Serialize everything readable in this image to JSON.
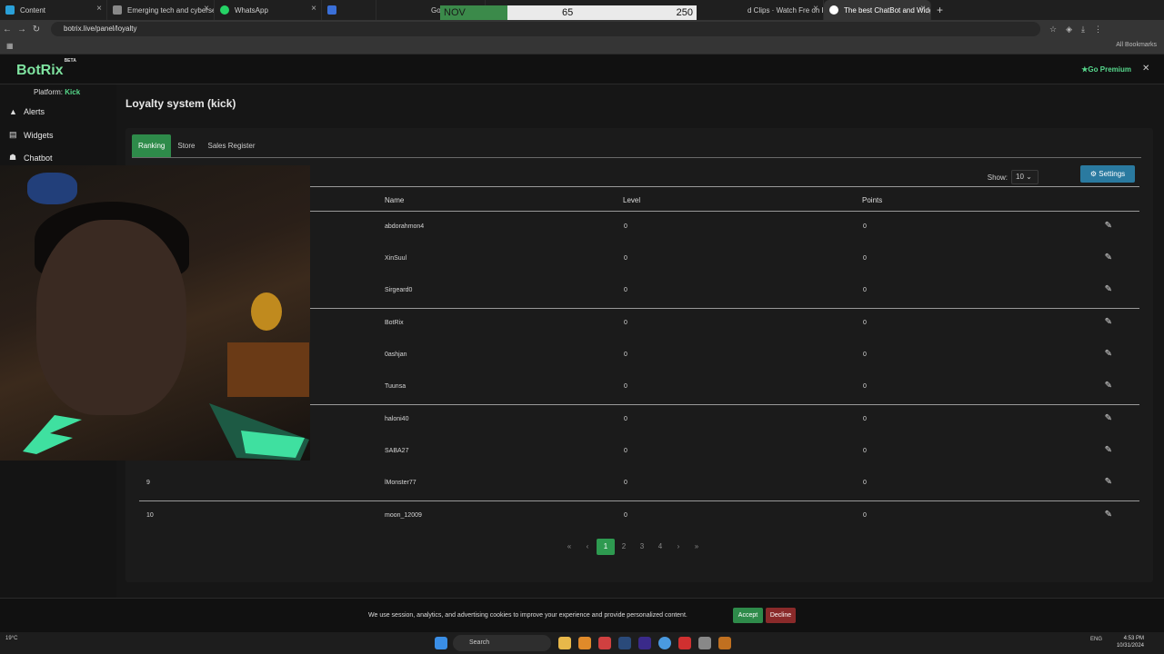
{
  "browser": {
    "tabs": [
      {
        "label": "Content",
        "color": "#2aa0d8"
      },
      {
        "label": "Emerging tech and cybersecur",
        "color": "#888888"
      },
      {
        "label": "WhatsApp",
        "color": "#25d366"
      },
      {
        "label": "",
        "color": "#3a6fd8"
      },
      {
        "label": "Google sugg",
        "color": "#888888"
      },
      {
        "label": "d Clips · Watch Fre on Ki",
        "color": "#888888"
      },
      {
        "label": "The best ChatBot and Widgets",
        "color": "#ffffff"
      }
    ],
    "overlay": {
      "month": "NOV",
      "value_a": "65",
      "value_b": "250"
    },
    "url": "botrix.live/panel/loyalty",
    "all_bookmarks": "All Bookmarks"
  },
  "app": {
    "logo": "BotRix",
    "logo_badge": "BETA",
    "premium_label": "Go Premium",
    "platform_prefix": "Platform:",
    "platform_value": "Kick",
    "sidebar": [
      {
        "label": "Alerts",
        "icon": "warning-icon"
      },
      {
        "label": "Widgets",
        "icon": "widgets-icon"
      },
      {
        "label": "Chatbot",
        "icon": "robot-icon"
      }
    ],
    "page_title": "Loyalty system (kick)",
    "tabs": [
      "Ranking",
      "Store",
      "Sales Register"
    ],
    "show_label": "Show:",
    "show_value": "10",
    "settings_label": "Settings",
    "columns": {
      "name": "Name",
      "level": "Level",
      "points": "Points"
    },
    "rows": [
      {
        "rank": "",
        "name": "abdorahmon4",
        "level": "0",
        "points": "0"
      },
      {
        "rank": "",
        "name": "XinSuul",
        "level": "0",
        "points": "0"
      },
      {
        "rank": "",
        "name": "Sirgeard0",
        "level": "0",
        "points": "0"
      },
      {
        "rank": "",
        "name": "BotRix",
        "level": "0",
        "points": "0"
      },
      {
        "rank": "",
        "name": "0ashjan",
        "level": "0",
        "points": "0"
      },
      {
        "rank": "",
        "name": "Tuunsa",
        "level": "0",
        "points": "0"
      },
      {
        "rank": "",
        "name": "haloni40",
        "level": "0",
        "points": "0"
      },
      {
        "rank": "",
        "name": "SABA27",
        "level": "0",
        "points": "0"
      },
      {
        "rank": "9",
        "name": "lMonster77",
        "level": "0",
        "points": "0"
      },
      {
        "rank": "10",
        "name": "moon_12009",
        "level": "0",
        "points": "0"
      }
    ],
    "pager": {
      "first": "«",
      "prev": "‹",
      "pages": [
        "1",
        "2",
        "3",
        "4"
      ],
      "next": "›",
      "last": "»"
    },
    "cookie": {
      "text": "We use session, analytics, and advertising cookies to improve your experience and provide personalized content.",
      "accept": "Accept",
      "decline": "Decline"
    }
  },
  "taskbar": {
    "weather": "19°C",
    "search_placeholder": "Search",
    "lang": "ENG",
    "time": "4:53 PM",
    "date": "10/31/2024"
  },
  "colors": {
    "accent": "#2e8b4a",
    "brand": "#7fe3a0",
    "info": "#2a7aa0",
    "danger": "#8a2a2a"
  }
}
